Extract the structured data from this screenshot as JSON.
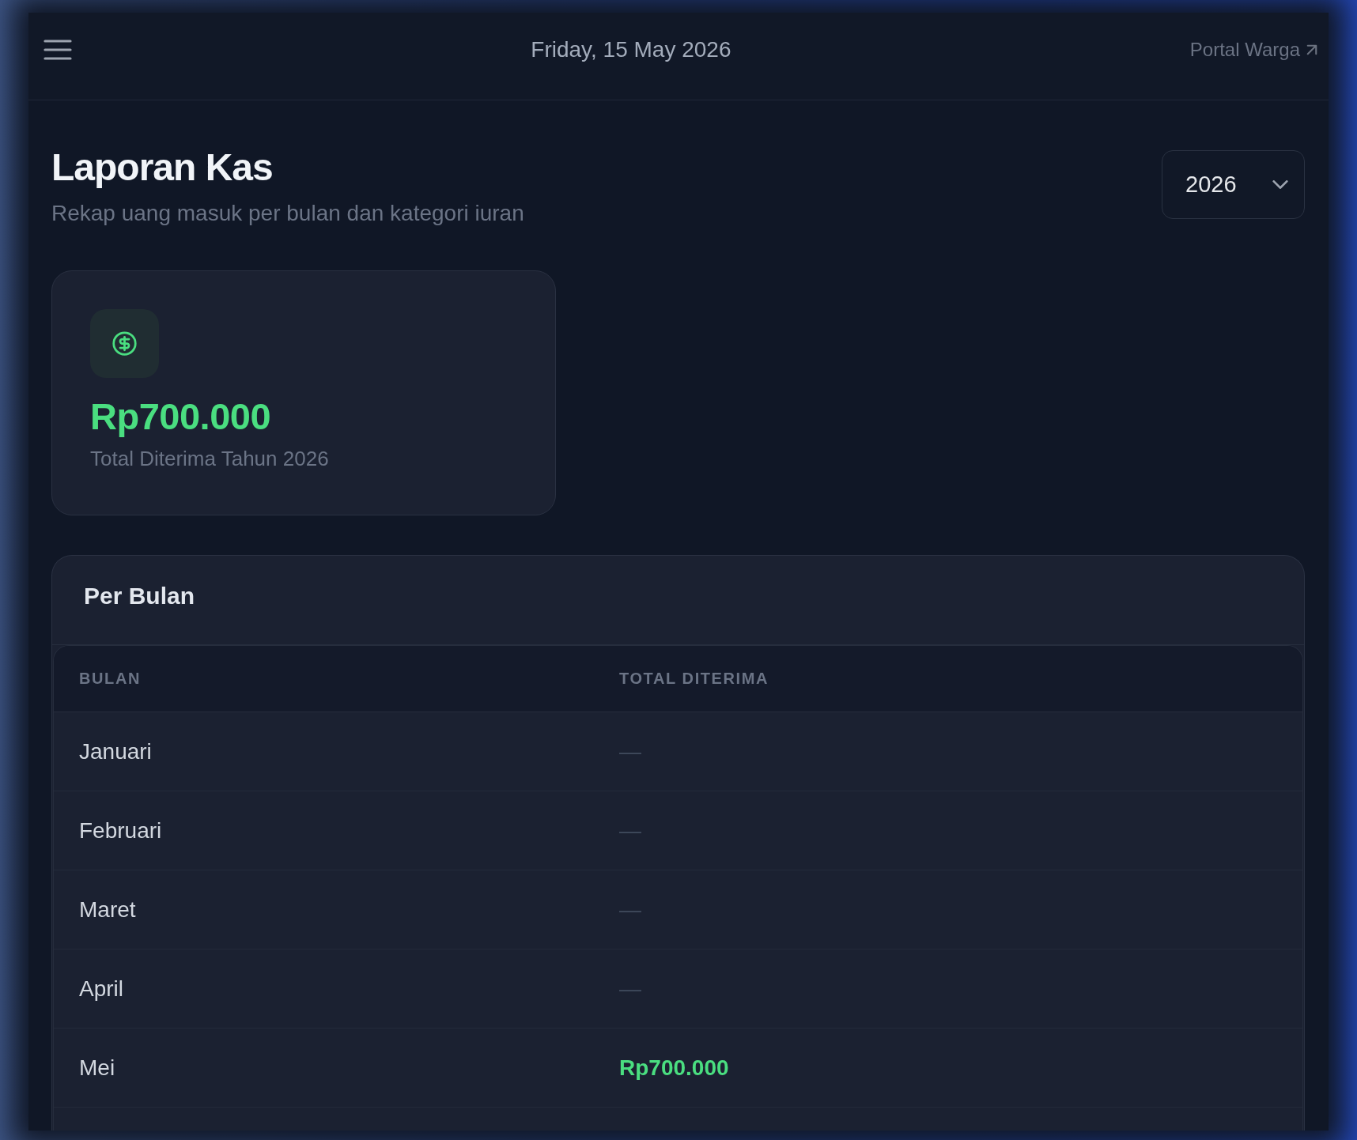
{
  "top_bar": {
    "date": "Friday, 15 May 2026",
    "portal_link": "Portal Warga"
  },
  "header": {
    "title": "Laporan Kas",
    "subtitle": "Rekap uang masuk per bulan dan kategori iuran",
    "year_select": {
      "value": "2026"
    }
  },
  "summary_card": {
    "amount": "Rp700.000",
    "label": "Total Diterima Tahun 2026"
  },
  "monthly_table": {
    "title": "Per Bulan",
    "columns": [
      "BULAN",
      "TOTAL DITERIMA"
    ],
    "rows": [
      {
        "month": "Januari",
        "total": "—",
        "kind": "empty"
      },
      {
        "month": "Februari",
        "total": "—",
        "kind": "empty"
      },
      {
        "month": "Maret",
        "total": "—",
        "kind": "empty"
      },
      {
        "month": "April",
        "total": "—",
        "kind": "empty"
      },
      {
        "month": "Mei",
        "total": "Rp700.000",
        "kind": "amount"
      }
    ]
  }
}
